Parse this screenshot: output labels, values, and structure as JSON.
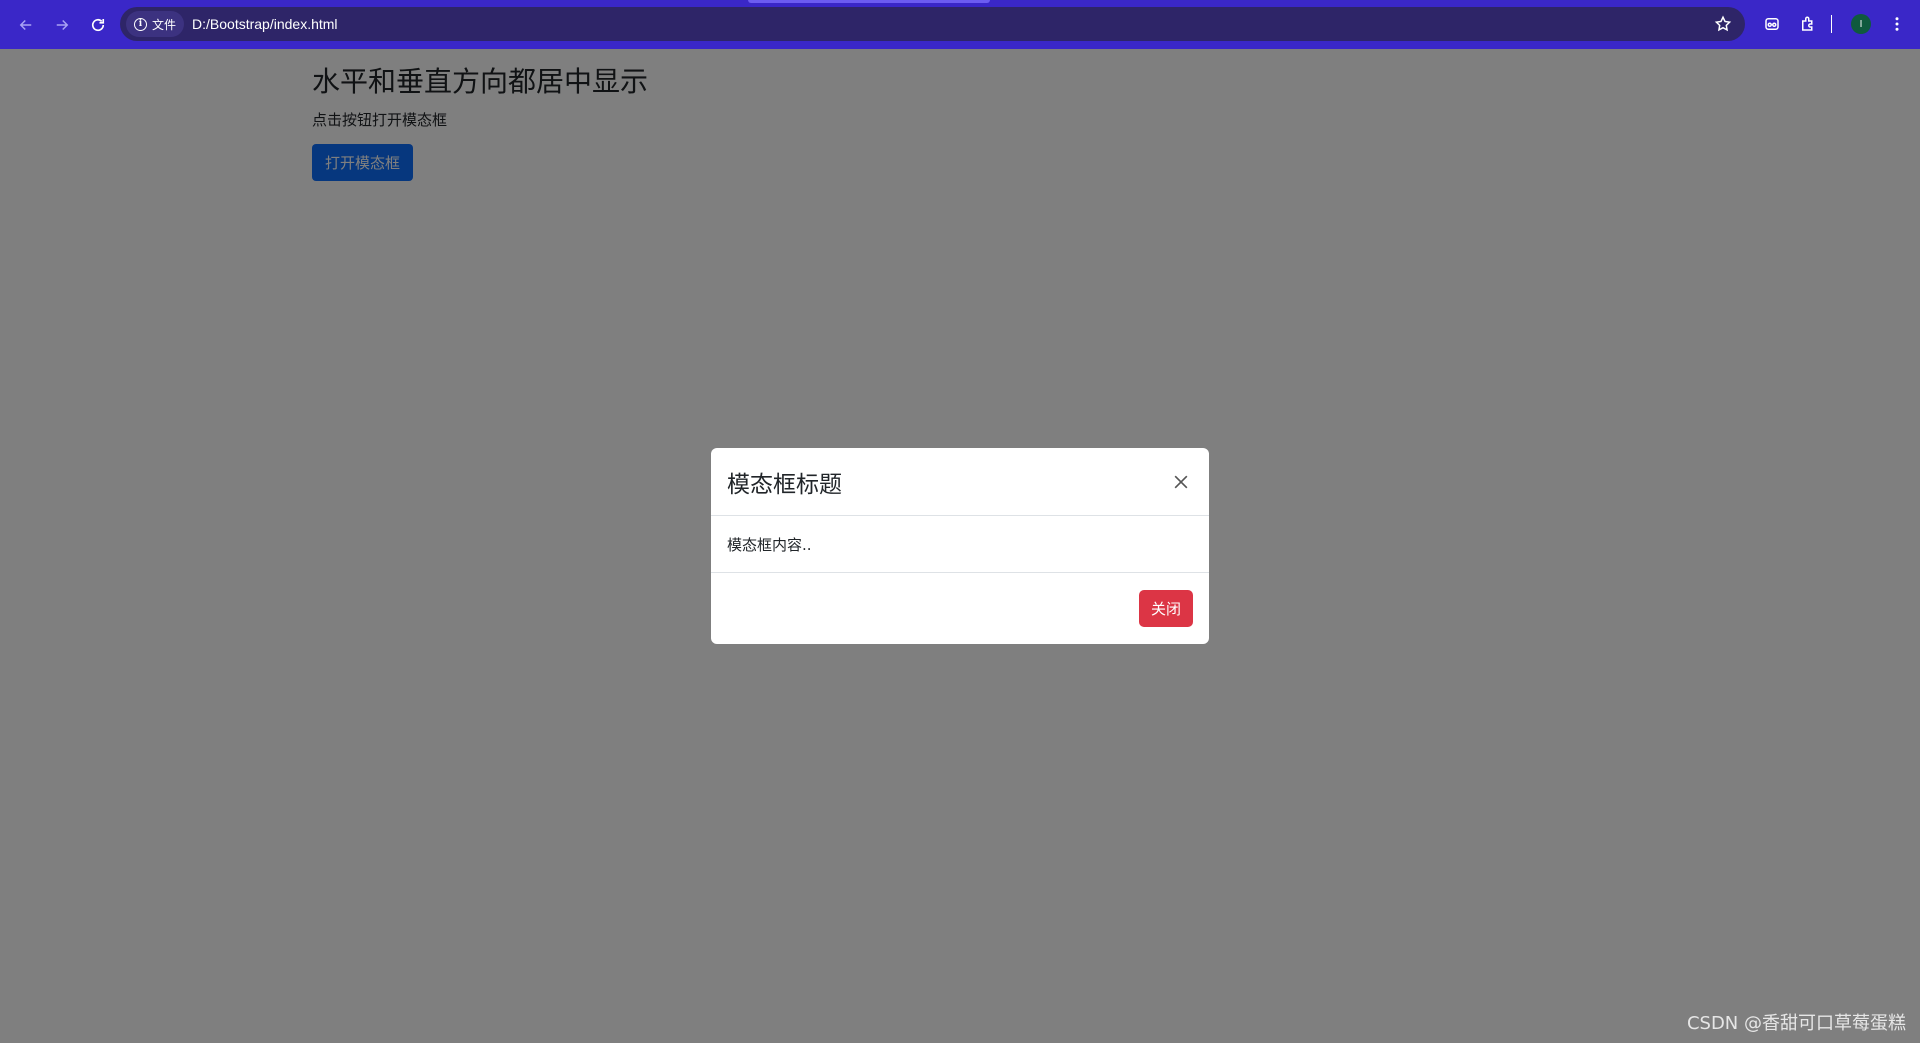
{
  "browser": {
    "url_scheme_label": "文件",
    "url": "D:/Bootstrap/index.html",
    "avatar_letter": "I",
    "accent_color": "#3a27c8"
  },
  "page": {
    "title": "水平和垂直方向都居中显示",
    "description": "点击按钮打开模态框",
    "open_button_label": "打开模态框",
    "open_button_color": "#0d6efd"
  },
  "modal": {
    "title": "模态框标题",
    "body": "模态框内容..",
    "close_button_label": "关闭",
    "close_button_color": "#dc3545"
  },
  "watermark": "CSDN @香甜可口草莓蛋糕"
}
